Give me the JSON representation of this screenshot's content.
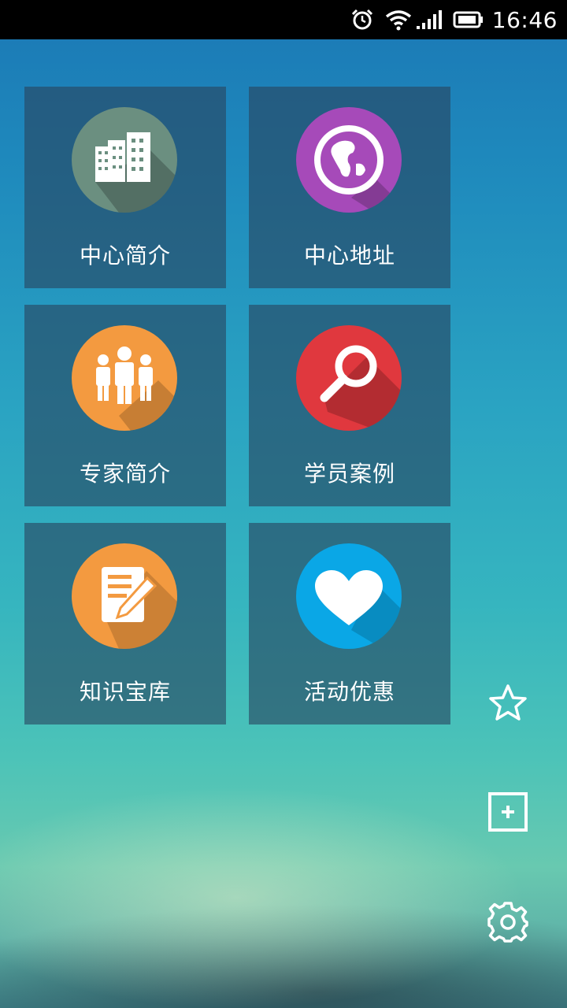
{
  "status_bar": {
    "time": "16:46",
    "icons": [
      "alarm-icon",
      "wifi-icon",
      "signal-icon",
      "battery-icon"
    ]
  },
  "tiles": [
    {
      "label": "中心简介",
      "icon": "buildings-icon",
      "color": "#6b8f80"
    },
    {
      "label": "中心地址",
      "icon": "globe-icon",
      "color": "#a64ab9"
    },
    {
      "label": "专家简介",
      "icon": "people-icon",
      "color": "#f39a40"
    },
    {
      "label": "学员案例",
      "icon": "search-icon",
      "color": "#e0383e"
    },
    {
      "label": "知识宝库",
      "icon": "notes-pen-icon",
      "color": "#f39a40"
    },
    {
      "label": "活动优惠",
      "icon": "heart-icon",
      "color": "#0aa7e6"
    }
  ],
  "side_actions": [
    {
      "icon": "star-icon"
    },
    {
      "icon": "add-icon"
    },
    {
      "icon": "gear-icon"
    }
  ]
}
